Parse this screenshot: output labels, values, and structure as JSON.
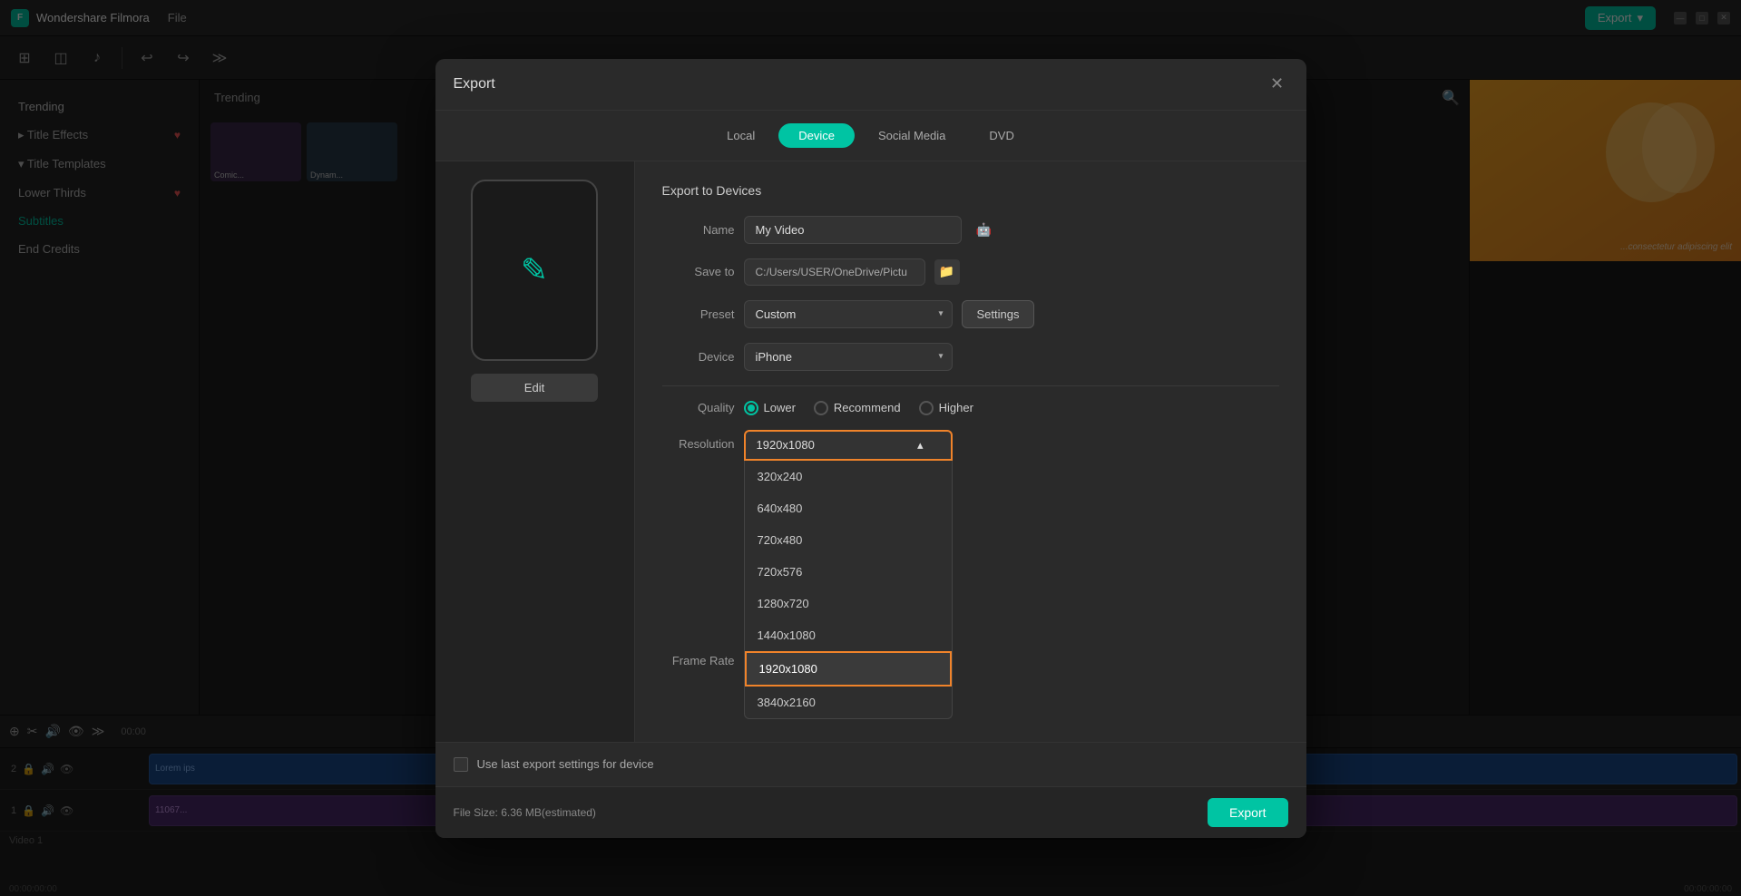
{
  "app": {
    "title": "Wondershare Filmora",
    "menu_items": [
      "File"
    ]
  },
  "header": {
    "export_label": "Export",
    "export_dropdown_arrow": "▾"
  },
  "toolbar": {
    "icons": [
      "⊞",
      "⊡",
      "↩",
      "↪",
      "≫"
    ]
  },
  "sidebar": {
    "search_icon": "🔍",
    "trending_label": "Trending",
    "items": [
      {
        "label": "Title Effects",
        "arrow": "▸",
        "has_heart": true
      },
      {
        "label": "Title Templates",
        "arrow": "▾",
        "has_heart": false
      },
      {
        "label": "Lower Thirds",
        "has_heart": true
      },
      {
        "label": "Subtitles",
        "active": true,
        "has_heart": false
      },
      {
        "label": "End Credits",
        "has_heart": false
      }
    ],
    "cards": [
      {
        "label": "Comic..."
      },
      {
        "label": "Dynam..."
      }
    ]
  },
  "modal": {
    "title": "Export",
    "close_icon": "✕",
    "tabs": [
      {
        "label": "Local",
        "active": false
      },
      {
        "label": "Device",
        "active": true
      },
      {
        "label": "Social Media",
        "active": false
      },
      {
        "label": "DVD",
        "active": false
      }
    ],
    "device_panel": {
      "edit_label": "Edit"
    },
    "form": {
      "section_title": "Export to Devices",
      "name_label": "Name",
      "name_value": "My Video",
      "save_to_label": "Save to",
      "save_to_value": "C:/Users/USER/OneDrive/Pictu",
      "folder_icon": "📁",
      "preset_label": "Preset",
      "preset_value": "Custom",
      "settings_label": "Settings",
      "device_label": "Device",
      "device_value": "iPhone",
      "quality_label": "Quality",
      "quality_options": [
        {
          "label": "Lower",
          "selected": true
        },
        {
          "label": "Recommend",
          "selected": false
        },
        {
          "label": "Higher",
          "selected": false
        }
      ],
      "resolution_label": "Resolution",
      "resolution_current": "1920x1080",
      "resolution_options": [
        {
          "value": "320x240",
          "selected": false
        },
        {
          "value": "640x480",
          "selected": false
        },
        {
          "value": "720x480",
          "selected": false
        },
        {
          "value": "720x576",
          "selected": false
        },
        {
          "value": "1280x720",
          "selected": false
        },
        {
          "value": "1440x1080",
          "selected": false
        },
        {
          "value": "1920x1080",
          "selected": true
        },
        {
          "value": "3840x2160",
          "selected": false
        }
      ],
      "frame_rate_label": "Frame Rate",
      "toggle1_on": true,
      "toggle2_off": false
    },
    "footer": {
      "file_size_label": "File Size:",
      "file_size_value": "6.36 MB(estimated)",
      "export_label": "Export",
      "checkbox_label": "Use last export settings for device"
    }
  },
  "timeline": {
    "tracks": [
      {
        "num": "2",
        "clip_label": "Lorem ips",
        "clip_type": "blue"
      },
      {
        "num": "1",
        "clip_label": "11067...",
        "clip_type": "purple"
      }
    ],
    "track_label": "Video 1",
    "time_start": "00:00",
    "time_current": "00",
    "time_end1": "00:00:00:00",
    "time_end2": "00:00:00:00"
  }
}
